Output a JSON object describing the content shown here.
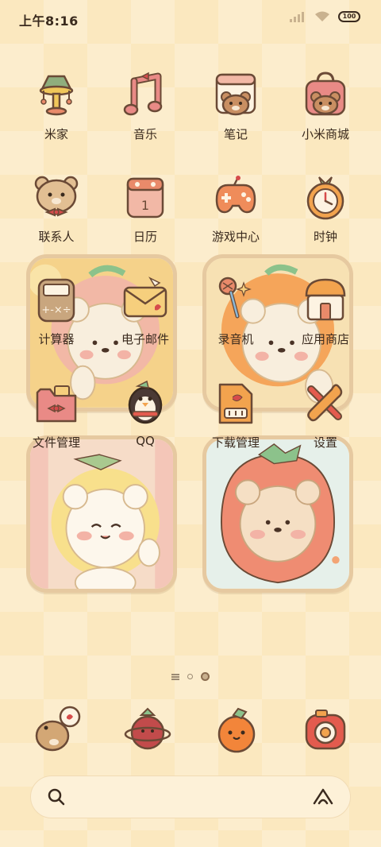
{
  "status_bar": {
    "time": "上午8:16",
    "battery": "100"
  },
  "apps_row1": [
    {
      "label": "米家",
      "icon": "lamp-icon"
    },
    {
      "label": "音乐",
      "icon": "music-note-icon"
    },
    {
      "label": "笔记",
      "icon": "bear-notepad-icon"
    },
    {
      "label": "小米商城",
      "icon": "bear-shopping-bag-icon"
    }
  ],
  "apps_row2": [
    {
      "label": "联系人",
      "icon": "bear-bowtie-icon"
    },
    {
      "label": "日历",
      "icon": "calendar-icon",
      "date": "1"
    },
    {
      "label": "游戏中心",
      "icon": "gamepad-icon"
    },
    {
      "label": "时钟",
      "icon": "clock-icon"
    }
  ],
  "apps_row3": [
    {
      "label": "计算器",
      "icon": "calculator-icon",
      "keys": "+-×÷"
    },
    {
      "label": "电子邮件",
      "icon": "envelope-icon"
    },
    {
      "label": "录音机",
      "icon": "microphone-icon"
    },
    {
      "label": "应用商店",
      "icon": "shop-house-icon"
    }
  ],
  "apps_row4": [
    {
      "label": "文件管理",
      "icon": "folder-bow-icon"
    },
    {
      "label": "QQ",
      "icon": "penguin-icon"
    },
    {
      "label": "下载管理",
      "icon": "download-file-icon"
    },
    {
      "label": "设置",
      "icon": "wrench-screwdriver-icon"
    }
  ],
  "widgets": [
    {
      "name": "bear-peach-widget",
      "theme": "peach"
    },
    {
      "name": "bear-orange-widget",
      "theme": "orange"
    },
    {
      "name": "bear-lemon-widget",
      "theme": "lemon"
    },
    {
      "name": "bear-strawberry-widget",
      "theme": "strawberry"
    }
  ],
  "page_indicator": {
    "pages": 3,
    "current": 3
  },
  "dock": [
    {
      "icon": "bear-chat-bubble-icon"
    },
    {
      "icon": "planet-strawberry-icon"
    },
    {
      "icon": "tangerine-icon"
    },
    {
      "icon": "camera-donut-icon"
    }
  ],
  "search_bar": {
    "icon_left": "search-icon",
    "icon_right": "xiaoai-icon"
  },
  "colors": {
    "background": "#fbe8bf",
    "text": "#3a2a1e",
    "outline": "#6b4a36",
    "widget_border": "#e6c9a0"
  }
}
